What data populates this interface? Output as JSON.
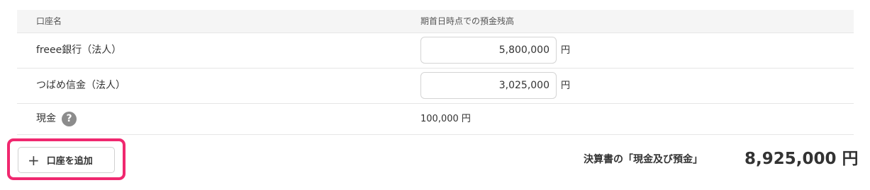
{
  "table": {
    "headers": {
      "account_name": "口座名",
      "opening_balance": "期首日時点での預金残高"
    },
    "rows": [
      {
        "name": "freee銀行（法人）",
        "amount": "5,800,000",
        "unit": "円"
      },
      {
        "name": "つばめ信金（法人）",
        "amount": "3,025,000",
        "unit": "円"
      }
    ],
    "cash": {
      "name": "現金",
      "amount": "100,000 円",
      "help": "?"
    }
  },
  "add_button": {
    "label": "口座を追加",
    "icon": "plus-icon"
  },
  "total": {
    "label": "決算書の「現金及び預金」",
    "value": "8,925,000 円"
  },
  "colors": {
    "highlight": "#f0286f",
    "header_bg": "#f5f5f5",
    "border": "#e6e6e6"
  }
}
